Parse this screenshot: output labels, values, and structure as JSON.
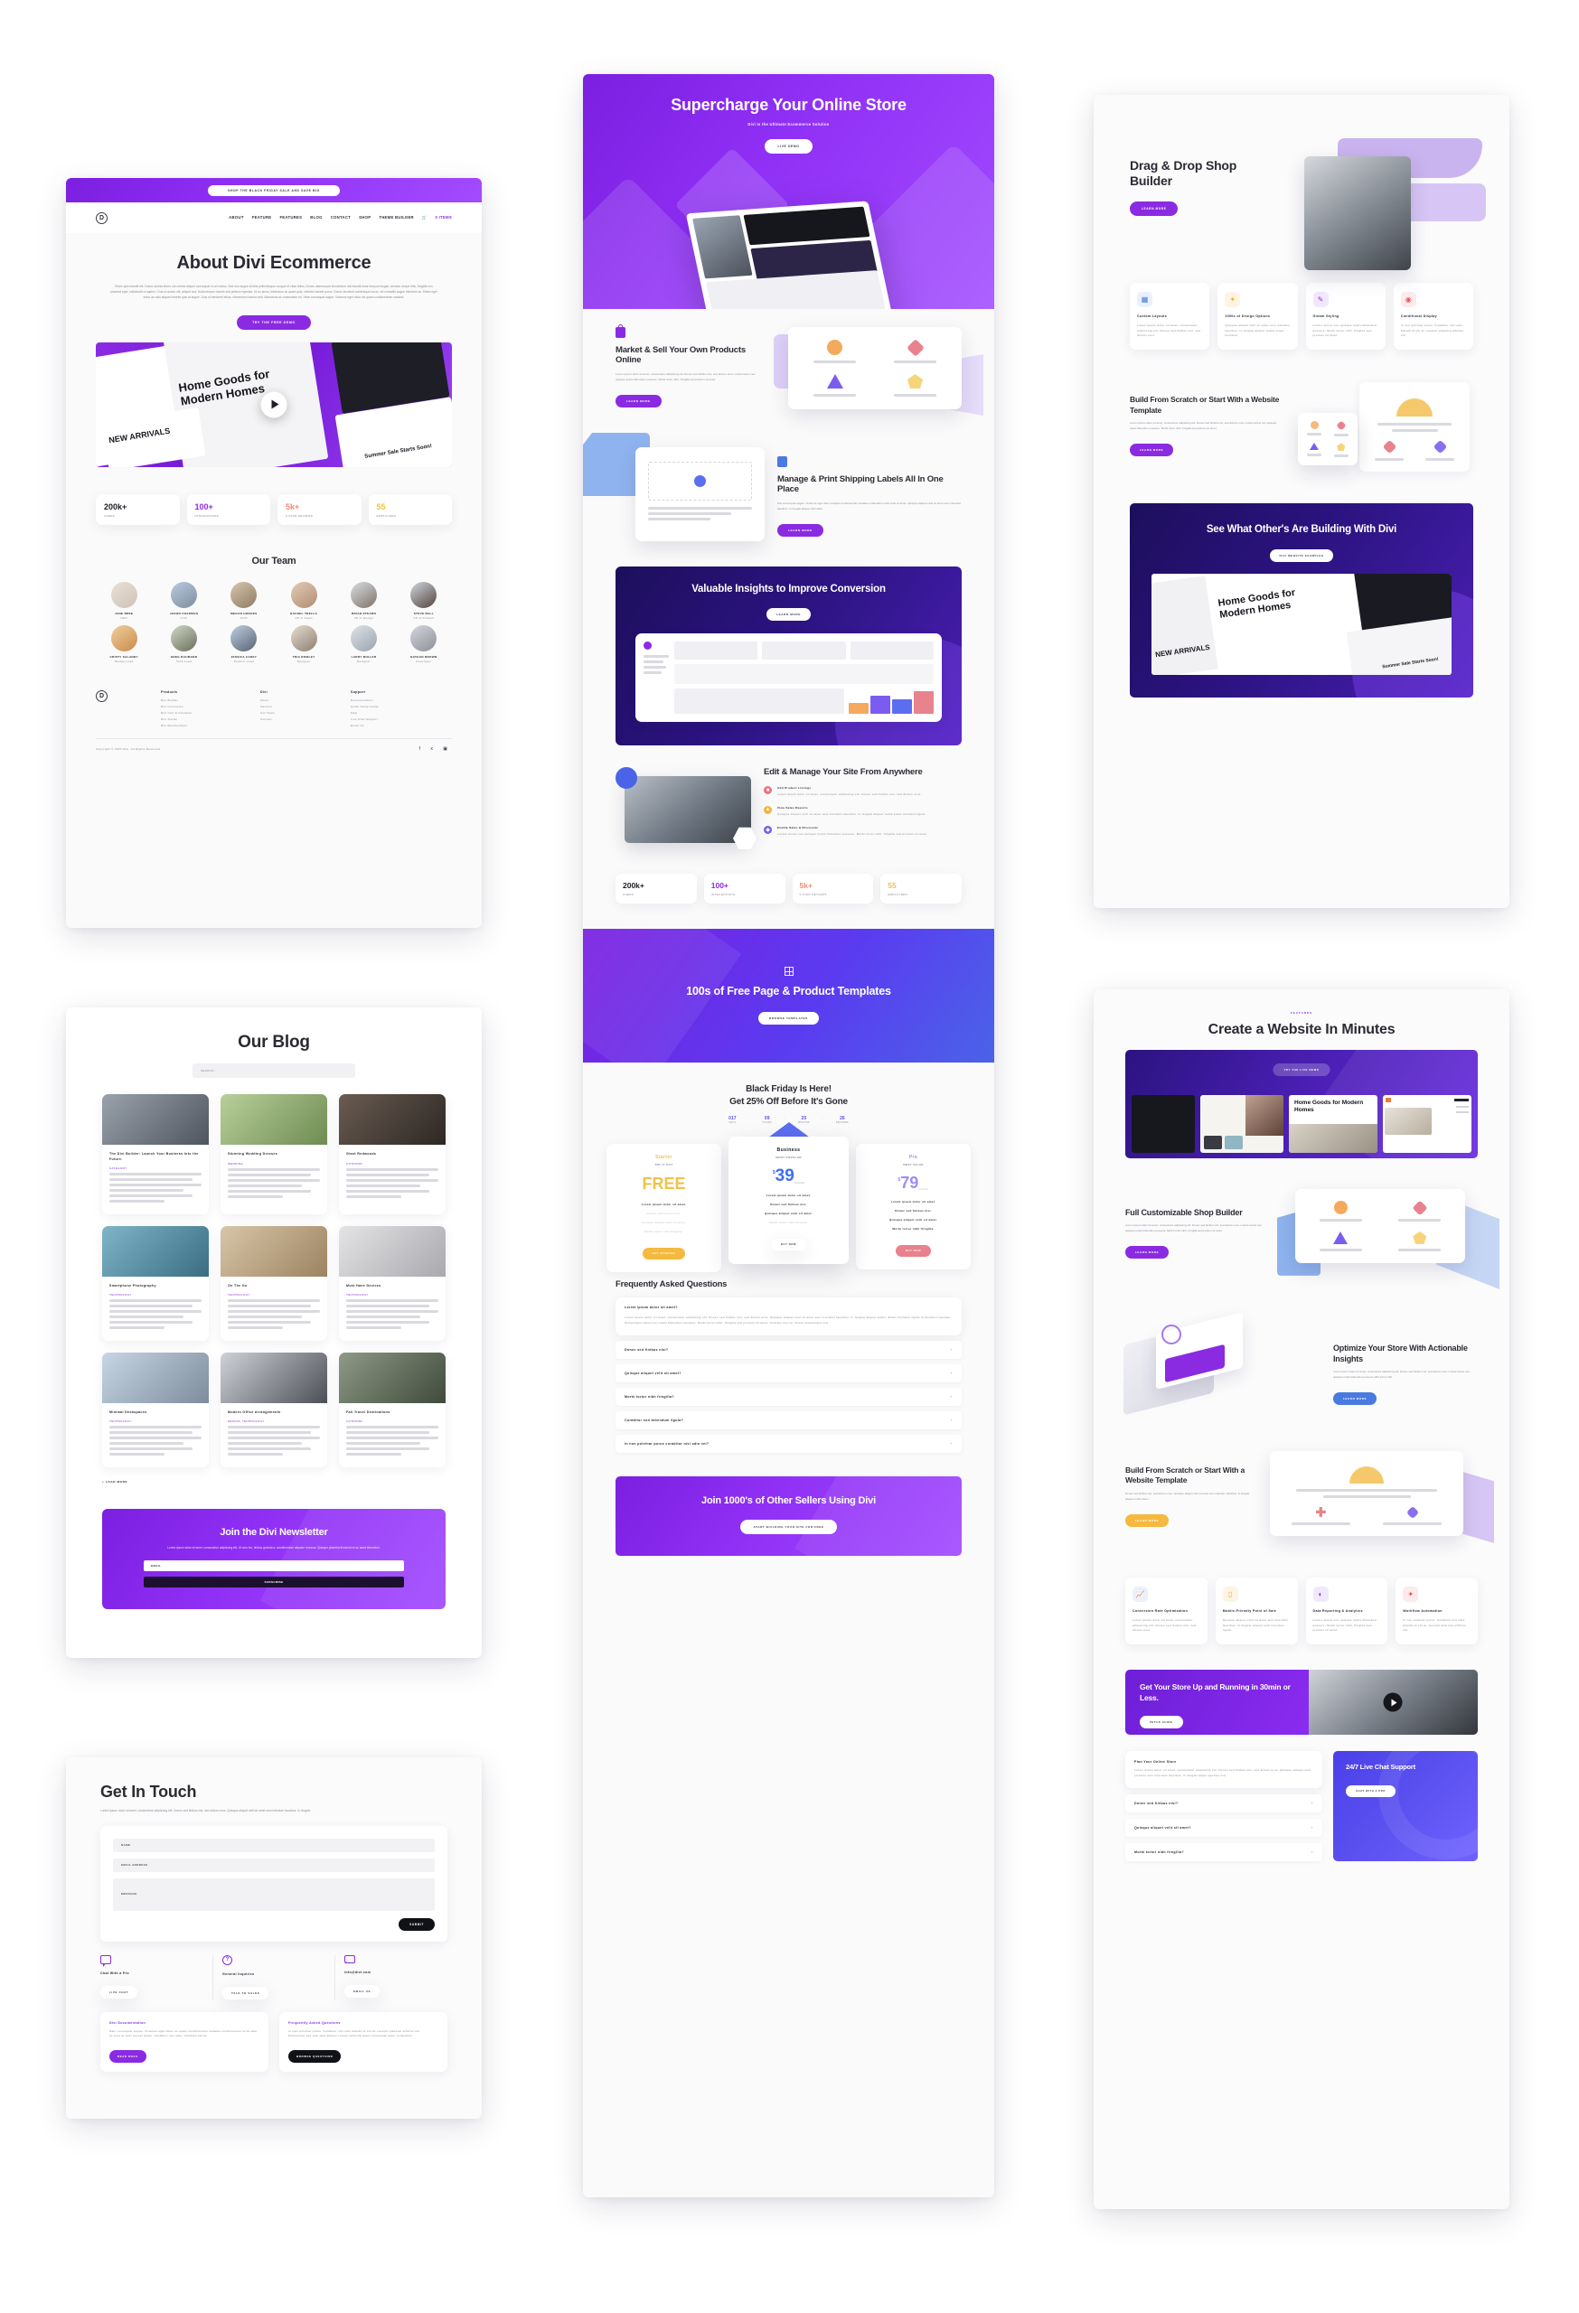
{
  "meta": {
    "accent": "#8a2be2",
    "accent_deep": "#2b1380",
    "blue": "#5b51f0"
  },
  "about_page": {
    "promo_bar": "SHOP THE BLACK FRIDAY SALE AND SAVE BIG",
    "nav": [
      "ABOUT",
      "FEATURE",
      "FEATURES",
      "BLOG",
      "CONTACT",
      "SHOP",
      "THEME BUILDER"
    ],
    "nav_cart": "0 ITEMS",
    "logo": "D",
    "title": "About Divi Ecommerce",
    "body": "Etiam quis blandit elit. Donec lacinia libero non metus aliquet consequat in vel metus. Sed non augue at felis pellentesque congue et vitae tellus. Donec ullamcorper fermentum nisi blandit dolor tempus feugiat. Aenean neque felis, fringilla non placerat eget, sollicitudin a sapien. Cras ut auctor elit, aliquet sed. Nulla tempor mauris sed pretium egestas. Ut eu lacus, bibendum ac quam quis, ultricies laoreet purus. Donec tincidunt scelerisque lacus, vel convallis augue interdum ac. Etiam eget tortor ac odio aliquet lobortis quis at augue. Duis ut hendrerit tellus, elementum lacinia velit. Maecenas at consectetur mi. Vitae consequat augue. Vivamus eget dolor vel quam condimentum sodales.",
    "cta": "TRY THE FREE DEMO",
    "video_caption": "Home Goods for Modern Homes",
    "video_badge": "NEW ARRIVALS",
    "video_badge2": "Summer Sale Starts Soon!",
    "stats": [
      {
        "value": "200k+",
        "label": "USERS",
        "color": "#1c1c26"
      },
      {
        "value": "100+",
        "label": "INTEGRATIONS",
        "color": "#8a2be2"
      },
      {
        "value": "5k+",
        "label": "5-STAR REVIEWS",
        "color": "#ef8d72"
      },
      {
        "value": "55",
        "label": "EMPLOYEES",
        "color": "#f0c24a"
      }
    ],
    "team_title": "Our Team",
    "team": [
      {
        "name": "JANE BREE",
        "role": "CEO"
      },
      {
        "name": "JASON CHAPMAN",
        "role": "CTO"
      },
      {
        "name": "MEGAN HODGES",
        "role": "COO"
      },
      {
        "name": "RACHEL TRELLO",
        "role": "VP of Sales"
      },
      {
        "name": "BRIAN STEARN",
        "role": "VP of Design"
      },
      {
        "name": "STEVE BALL",
        "role": "VP of Product"
      },
      {
        "name": "CRISTY SALANDY",
        "role": "Design Lead"
      },
      {
        "name": "GREG BAUMANN",
        "role": "Tech Lead"
      },
      {
        "name": "JESSICA CAREY",
        "role": "Product Lead"
      },
      {
        "name": "TRIA ROWLEY",
        "role": "Designer"
      },
      {
        "name": "LARRY MULLER",
        "role": "Designer"
      },
      {
        "name": "NATHAN BROWN",
        "role": "Developer"
      }
    ],
    "footer": {
      "columns": [
        {
          "heading": "Products",
          "links": [
            "Divi Builder",
            "Divi Commerce",
            "Divi Cart & Checkout",
            "Divi Social",
            "Divi Memberships"
          ]
        },
        {
          "heading": "Divi",
          "links": [
            "About",
            "Careers",
            "Our Team",
            "Contact"
          ]
        },
        {
          "heading": "Support",
          "links": [
            "Documentation",
            "Quick Setup Guide",
            "FAQ",
            "Live Chat Support",
            "Email Us"
          ]
        }
      ],
      "copyright": "Copyright © 2023 Divi. All Rights Reserved.",
      "socials": [
        "facebook-icon",
        "twitter-icon",
        "instagram-icon"
      ]
    }
  },
  "blog_page": {
    "title": "Our Blog",
    "search_placeholder": "SEARCH...",
    "posts": [
      {
        "title": "The Divi Builder: Launch Your Business Into the Future.",
        "category": "CATEGORY"
      },
      {
        "title": "Stunning Wedding Dresses",
        "category": "WEDDING"
      },
      {
        "title": "Giant Redwoods",
        "category": "OUTDOOR"
      },
      {
        "title": "Smartphone Photography",
        "category": "TECHNOLOGY"
      },
      {
        "title": "On The Go",
        "category": "TECHNOLOGY"
      },
      {
        "title": "Must Have Devices",
        "category": "TECHNOLOGY"
      },
      {
        "title": "Minimal Deskspaces",
        "category": "TECHNOLOGY"
      },
      {
        "title": "Modern Office Arrangements",
        "category": "DESIGN, TECHNOLOGY"
      },
      {
        "title": "Fall Travel Destinations",
        "category": "OUTDOOR"
      }
    ],
    "load_more": "+ LOAD MORE",
    "newsletter": {
      "title": "Join the Divi Newsletter",
      "body": "Lorem ipsum dolor sit amet, consectetur adipiscing elit. Ut arcu leo, finibus gravida a, condimentum aliquam rhoncus. Quisque pharetra tincidunt mi ac amet bibendum.",
      "email_placeholder": "EMAIL",
      "button": "SUBSCRIBE"
    }
  },
  "contact_page": {
    "title": "Get In Touch",
    "body": "Lorem ipsum dolor sit amet, consectetur adipiscing elit. Donec sed finibus nisi, sed dictum eros. Quisque aliquet velit sit amet sem interdum faucibus. In feugiat.",
    "form": {
      "name_placeholder": "NAME",
      "email_placeholder": "EMAIL ADDRESS",
      "message_placeholder": "MESSAGE",
      "submit": "SUBMIT"
    },
    "channels": [
      {
        "icon": "chat-bubble-icon",
        "title": "Chat With a Pro",
        "button": "LIVE CHAT"
      },
      {
        "icon": "question-circle-icon",
        "title": "General Inquiries",
        "button": "TALK TO SALES"
      },
      {
        "icon": "envelope-open-icon",
        "title": "info@divi.com",
        "button": "EMAIL US"
      }
    ],
    "help_cards": [
      {
        "title": "Divi Documentation",
        "body": "Nam consequat augue. Vivamus eget dolor eu quam condimentum sodales condimentum urna odio, ac eros at velit posuer quam. Curabitur nec odio, tincidunt elit ac.",
        "button": "READ DOCS",
        "button_style": "purple"
      },
      {
        "title": "Frequently Asked Questions",
        "body": "In nam pulvinar purus. Curabitur nisl odio blandit id elit ac suscipit placerat efficitur elit. Fermentum sed sem quis aliquet cursus vehicula quam consequat dolor ut facilisis.",
        "button": "BROWSE QUESTIONS",
        "button_style": "dark"
      }
    ]
  },
  "home_page": {
    "hero": {
      "title": "Supercharge Your Online Store",
      "subtitle": "Divi Is the Ultimate Ecommerce Solution",
      "cta": "LIVE DEMO"
    },
    "feature_market": {
      "icon": "shopping-bag-icon",
      "title": "Market & Sell Your Own Products Online",
      "body": "Lorem ipsum dolor sit amet, consectetur adipiscing elit. Donec sed finibus nisi, sed dictum eros. Luctus lacus nec quisque turpis bibendum posuere. Morbi tortor nibh, fringilla sed pretium sit amet.",
      "cta": "LEARN MORE"
    },
    "feature_shipping": {
      "icon": "shipping-label-icon",
      "title": "Manage & Print Shipping Labels All In One Place",
      "body": "Nisi consequat augue. Vivamus eget dolor volutpat condimentum sodales a bibendum odio ante at amet. Quisque aliquet velit sit amet sem interdum faucibus. In feugiat aliquet nibh diam.",
      "cta": "LEARN MORE"
    },
    "insights_banner": {
      "title": "Valuable Insights to Improve Conversion",
      "cta": "LEARN MORE"
    },
    "edit_manage": {
      "title": "Edit & Manage Your Site From Anywhere",
      "items": [
        {
          "icon": "grid-icon",
          "color": "#ef6f7c",
          "title": "Add Product Listings",
          "body": "Lorem ipsum dolor sit amet, consectetur adipiscing elit. Donec sed finibus nisi, sed dictum eros."
        },
        {
          "icon": "chart-icon",
          "color": "#f2b63d",
          "title": "View Sales Reports",
          "body": "Quisque aliquet velit sit amet sem interdum faucibus. In feugiat aliquet molla etiam tincidunt ligula."
        },
        {
          "icon": "tag-icon",
          "color": "#7b5cf0",
          "title": "Enable Sales & Discounts",
          "body": "Luctus lectus non quisque turpis bibendum posuere. Morbi tortor nibh, fringilla sed pretium sit amet."
        }
      ]
    },
    "stats": [
      {
        "value": "200k+",
        "label": "USERS",
        "color": "#1c1c26"
      },
      {
        "value": "100+",
        "label": "INTEGRATIONS",
        "color": "#8a2be2"
      },
      {
        "value": "5k+",
        "label": "5-STAR REVIEWS",
        "color": "#ef8d72"
      },
      {
        "value": "55",
        "label": "EMPLOYEES",
        "color": "#f0c24a"
      }
    ],
    "templates_banner": {
      "icon": "layout-grid-icon",
      "title": "100s of Free Page & Product Templates",
      "cta": "BROWSE TEMPLATES"
    },
    "pricing": {
      "title_line1": "Black Friday Is Here!",
      "title_line2": "Get 25% Off Before It's Gone",
      "countdown": [
        {
          "value": "017",
          "label": "DAYS"
        },
        {
          "value": "09",
          "label": "HOURS"
        },
        {
          "value": "20",
          "label": "MINUTES"
        },
        {
          "value": "26",
          "label": "SECONDS"
        }
      ],
      "plans": [
        {
          "name": "Starter",
          "tagline": "TRY IT OUT",
          "currency": "",
          "price": "FREE",
          "period": "",
          "color": "#f0c24a",
          "features": [
            "Lorem ipsum dolor sit amet.",
            "Donec sed finibus nisi.",
            "Quisque aliquet velit sit amet.",
            "Morbi tortor nibh fringilla."
          ],
          "enabled": [
            true,
            false,
            false,
            false
          ],
          "cta": "GET STARTED"
        },
        {
          "name": "Business",
          "tagline": "MOST POPULAR",
          "currency": "$",
          "price": "39",
          "period": "/month",
          "color": "#3e6ef0",
          "features": [
            "Lorem ipsum dolor sit amet.",
            "Donec sed finibus nisi.",
            "Quisque aliquet velit sit amet.",
            "Morbi tortor nibh fringilla."
          ],
          "enabled": [
            true,
            true,
            true,
            false
          ],
          "cta": "BUY NOW"
        },
        {
          "name": "Pro",
          "tagline": "BEST VALUE",
          "currency": "$",
          "price": "79",
          "period": "/month",
          "color": "#a08cf5",
          "features": [
            "Lorem ipsum dolor sit amet.",
            "Donec sed finibus nisi.",
            "Quisque aliquet velit sit amet.",
            "Morbi tortor nibh fringilla."
          ],
          "enabled": [
            true,
            true,
            true,
            true
          ],
          "cta": "BUY NOW"
        }
      ]
    },
    "faq": {
      "title": "Frequently Asked Questions",
      "open_item": {
        "question": "Lorem ipsum dolor sit amet?",
        "answer": "Lorem ipsum dolor sit amet, consectetur adipiscing elit. Donec sed finibus nisi, sed dictum eros. Quisque aliquet velit sit amet sem interdum faucibus. In feugiat aliquet mollis. Etiam tincidunt ligula id hendrerit aenean. Scelerisque lacus nec turpis bibendum posuere. Morbi tortor nibh, fringilla sed pretium sit amet, ultricies nisi nu. Fusce scelerisque nisl."
      },
      "items": [
        "Donec sed finibus nisi?",
        "Quisque aliquet velit sit amet?",
        "Morbi tortor nibh fringilla?",
        "Curabitur non bibendum ligula?",
        "In non pulvinar purus curabitur nisl odio vel?"
      ]
    },
    "final_cta": {
      "title": "Join 1000's of Other Sellers Using Divi",
      "button": "START BUILDING YOUR SITE FOR FREE"
    }
  },
  "features_page": {
    "hero": {
      "title": "Drag & Drop Shop Builder",
      "cta": "LEARN MORE"
    },
    "cards": [
      {
        "icon": "layout-grid-icon",
        "tone": "b",
        "title": "Custom Layouts",
        "body": "Lorem ipsum dolor sit amet, consectetur adipiscing elit. Donec sed finibus nisi, sed dictum eros."
      },
      {
        "icon": "wand-icon",
        "tone": "y",
        "title": "1000s of Design Options",
        "body": "Quisque aliquet velit sit amet sem interdum faucibus. In feugiat aliquet mollis etiam tincidunt."
      },
      {
        "icon": "brush-icon",
        "tone": "p",
        "title": "Global Styling",
        "body": "Luctus lectus non quisque turpis bibendum posuere. Morbi tortor nibh, fringilla sed pretium sit amet."
      },
      {
        "icon": "eye-icon",
        "tone": "r",
        "title": "Conditional Display",
        "body": "In non pulvinar purus. Curabitur nisl odio, blandit id elit at, suscipit pharetra efficitur elit."
      }
    ],
    "scratch": {
      "title": "Build From Scratch or Start With a Website Template",
      "body": "Lorem ipsum dolor sit amet, consectetur adipiscing elit. Donec sed finibus nisi, sed dictum eros. Luctus lectus non quisque turpis bibendum posuere. Morbi tortor nibh, fringilla sed pretium sit amet.",
      "cta": "LEARN MORE"
    },
    "showcase": {
      "title": "See What Other's Are Building With Divi",
      "cta": "DIVI WEBSITE EXAMPLES",
      "caption": "Home Goods for Modern Homes",
      "badge": "NEW ARRIVALS",
      "badge2": "Summer Sale Starts Soon!"
    }
  },
  "minutes_page": {
    "eyebrow": "FEATURES",
    "title": "Create a Website In Minutes",
    "demo_cta": "TRY THE LIVE DEMO",
    "showcase_caption": "Home Goods for Modern Homes",
    "shop_builder": {
      "title": "Full Customizable Shop Builder",
      "body": "Lorem ipsum dolor sit amet, consectetur adipiscing elit. Donec sed finibus nisi, sed dictum eros. Luctus lectus non quisque turpis bibendum posuere. Morbi tortor nibh, fringilla sed pretium sit amet.",
      "cta": "LEARN MORE"
    },
    "optimize": {
      "title": "Optimize Your Store With Actionable Insights",
      "body": "Lorem ipsum dolor sit amet, consectetur adipiscing elit. Donec sed finibus nisi, sed dictum eros. Luctus lectus non quisque turpis bibendum posuere nibh tortor nibh.",
      "cta": "LEARN MORE"
    },
    "scratch": {
      "title": "Build From Scratch or Start With a Website Template",
      "body": "Donec sed finibus nisi, sed dictum eros. Quisque aliquet velit sit amet sem interdum faucibus. In feugiat aliquet mollis etiam.",
      "cta": "LEARN MORE"
    },
    "cards": [
      {
        "icon": "chart-bar-icon",
        "tone": "b",
        "title": "Conversion Rate Optimization",
        "body": "Lorem ipsum dolor sit amet, consectetur adipiscing elit. Donec sed finibus nisi, sed dictum eros."
      },
      {
        "icon": "mobile-icon",
        "tone": "y",
        "title": "Mobile-Friendly Point of Sale",
        "body": "Quisque aliquet velit sit amet sem interdum faucibus. In feugiat aliquet velit interdum ligula."
      },
      {
        "icon": "pie-chart-icon",
        "tone": "p",
        "title": "Data Reporting & Analytics",
        "body": "Luctus lectus non quisque turpis bibendum posuere. Morbi tortor nibh, fringilla sed pretium sit amet."
      },
      {
        "icon": "wand-icon",
        "tone": "r",
        "title": "Workflow Automation",
        "body": "In non pulvinar purus. Curabitur nisl odio, blandit id elit at, suscipit pharetra efficitur elit."
      }
    ],
    "video_cta": {
      "title": "Get Your Store Up and Running in 30min or Less.",
      "button": "SETUP GUIDE"
    },
    "plan_card": {
      "title": "Plan Your Online Store",
      "body": "Lorem ipsum dolor sit amet, consectetur adipiscing elit. Donec sed finibus nisi, sed dictum eros. Quisque aliquet velit sit amet sem interdum faucibus. In feugiat atque egestas nisi."
    },
    "faq_items": [
      "Donec sed finibus nisi?",
      "Quisque aliquet velit sit amet?",
      "Morbi tortor nibh fringilla?"
    ],
    "support_card": {
      "title": "24/7 Live Chat Support",
      "button": "CHAT WITH A PRO"
    }
  }
}
